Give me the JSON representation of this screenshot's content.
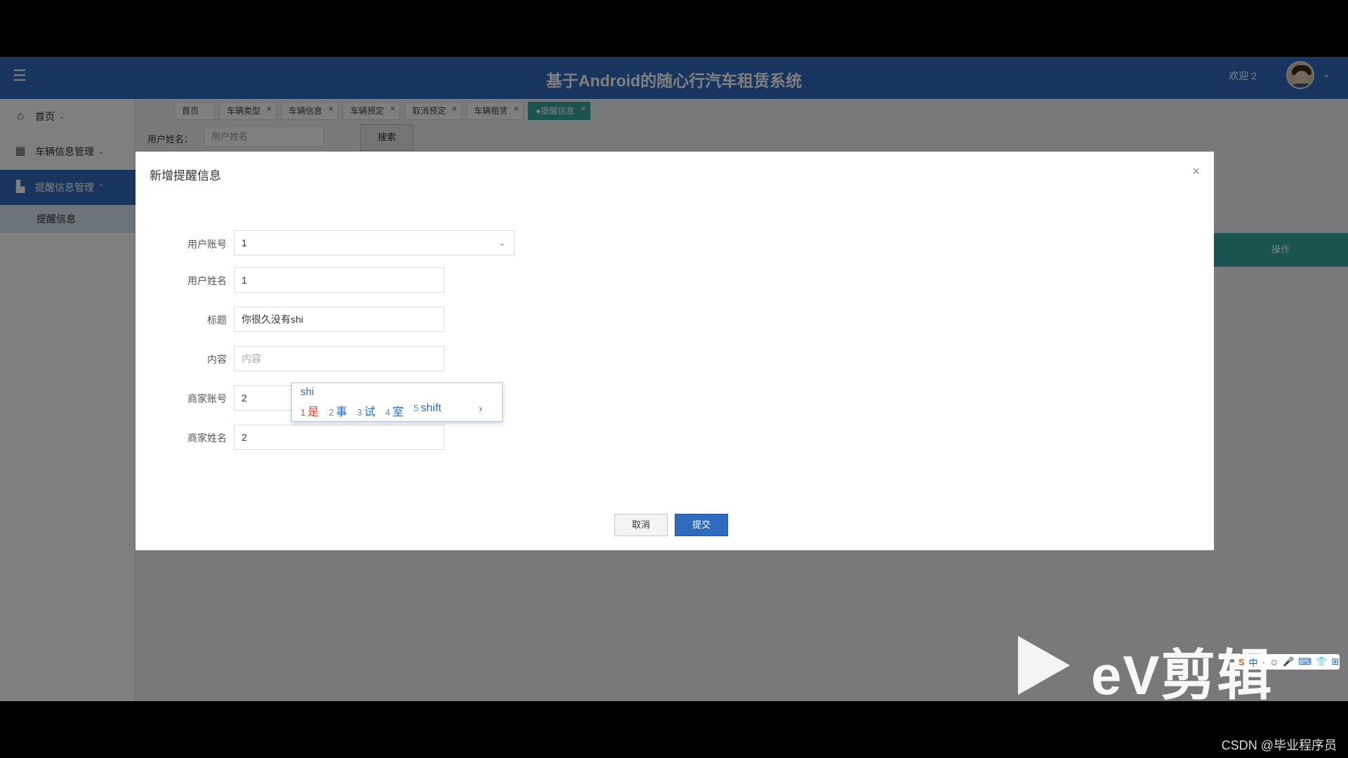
{
  "header": {
    "title": "基于Android的随心行汽车租赁系统",
    "welcome": "欢迎 2",
    "menu_icon": "hamburger-icon",
    "avatar_icon": "user-avatar"
  },
  "sidebar": {
    "items": [
      {
        "label": "首页",
        "icon": "home-icon"
      },
      {
        "label": "车辆信息管理",
        "icon": "car-info-icon"
      },
      {
        "label": "提醒信息管理",
        "icon": "bell-icon"
      }
    ],
    "sub_item": "提醒信息"
  },
  "tabs": [
    "首页",
    "车辆类型",
    "车辆信息",
    "车辆预定",
    "取消预定",
    "车辆租赁",
    "●提醒信息"
  ],
  "search": {
    "label": "用户姓名：",
    "placeholder": "用户姓名",
    "button": "搜索"
  },
  "table": {
    "op_header": "操作"
  },
  "modal": {
    "title": "新增提醒信息",
    "fields": [
      {
        "label": "用户账号",
        "value": "1"
      },
      {
        "label": "用户姓名",
        "value": "1"
      },
      {
        "label": "标题",
        "value": "你很久没有shi"
      },
      {
        "label": "内容",
        "placeholder": "内容"
      },
      {
        "label": "商家账号",
        "value": "2"
      },
      {
        "label": "商家姓名",
        "value": "2"
      }
    ],
    "cancel": "取消",
    "submit": "提交"
  },
  "ime": {
    "composition": "shi",
    "candidates": [
      {
        "n": "1",
        "text": "是"
      },
      {
        "n": "2",
        "text": "事"
      },
      {
        "n": "3",
        "text": "试"
      },
      {
        "n": "4",
        "text": "室"
      },
      {
        "n": "5",
        "text": "shift"
      }
    ],
    "toolbar": [
      "S",
      "中",
      "·",
      "☺",
      "🎤",
      "⌨",
      "👕",
      "⊞"
    ]
  },
  "watermark": {
    "ev": "eV剪辑",
    "csdn": "CSDN @毕业程序员"
  },
  "colors": {
    "primary": "#2e6bbf",
    "teal": "#34a6a0"
  }
}
